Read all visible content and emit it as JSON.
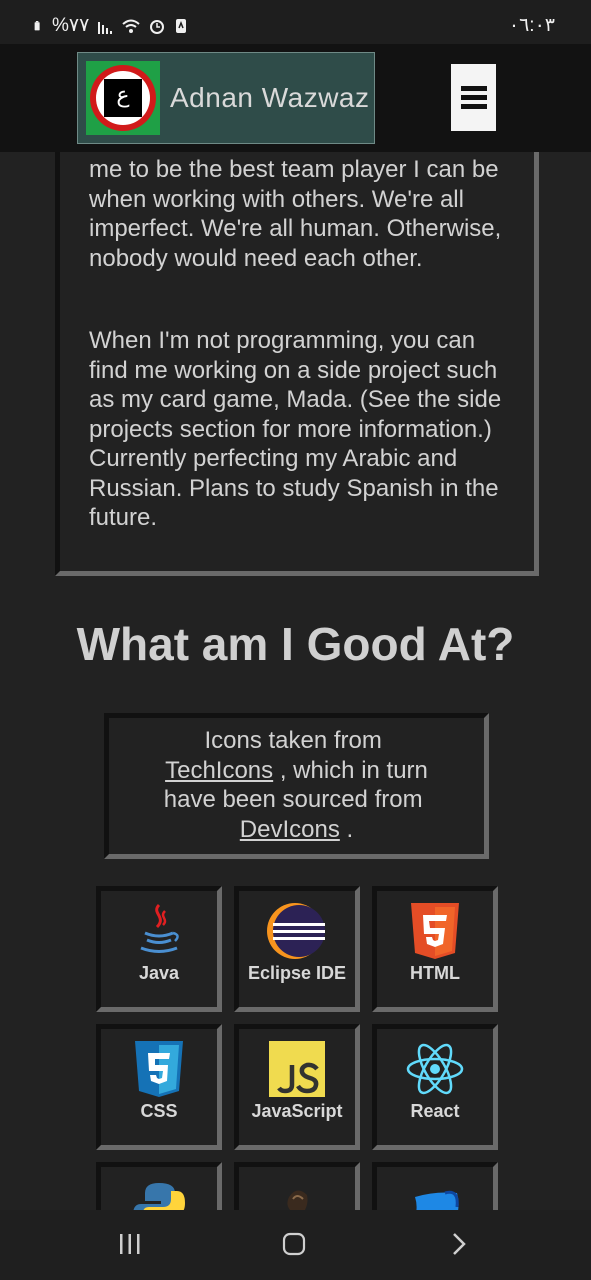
{
  "status_bar": {
    "left_text": "%٧٧",
    "time": "٠٦:٠٣"
  },
  "navbar": {
    "brand_name": "Adnan Wazwaz",
    "logo_glyph": "ع",
    "menu_icon": "hamburger-menu-icon"
  },
  "about": {
    "paragraph1": "me to be the best team player I can be when working with others. We're all imperfect. We're all human. Otherwise, nobody would need each other.",
    "paragraph2": "When I'm not programming, you can find me working on a side project such as my card game, Mada. (See the side projects section for more information.) Currently perfecting my Arabic and Russian. Plans to study Spanish in the future."
  },
  "skills": {
    "title": "What am I Good At?",
    "credits": {
      "prefix": "Icons taken from",
      "link1": "TechIcons",
      "middle": ", which in turn have been sourced from",
      "link2": "DevIcons",
      "suffix": "."
    },
    "items": [
      {
        "label": "Java",
        "icon": "java-icon"
      },
      {
        "label": "Eclipse IDE",
        "icon": "eclipse-icon"
      },
      {
        "label": "HTML",
        "icon": "html5-icon"
      },
      {
        "label": "CSS",
        "icon": "css3-icon"
      },
      {
        "label": "JavaScript",
        "icon": "javascript-icon"
      },
      {
        "label": "React",
        "icon": "react-icon"
      },
      {
        "label": "",
        "icon": "python-icon"
      },
      {
        "label": "",
        "icon": "jenkins-icon"
      },
      {
        "label": "",
        "icon": "azure-data-studio-icon"
      }
    ]
  },
  "colors": {
    "background": "#222222",
    "brand_bg": "#2f4c49",
    "logo_green": "#1fa046",
    "logo_red": "#d11a1a"
  }
}
